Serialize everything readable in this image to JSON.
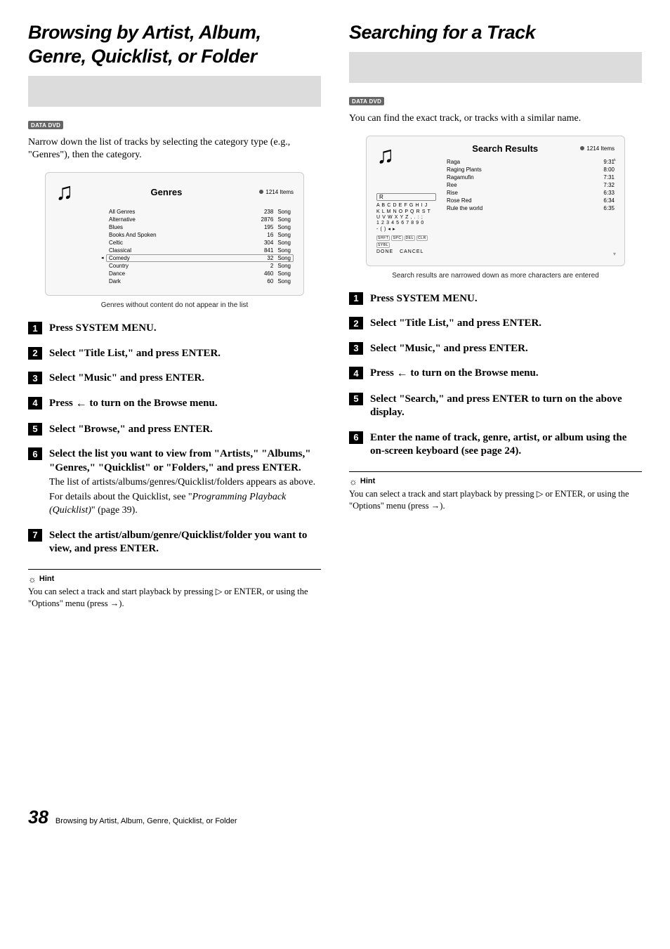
{
  "left": {
    "title": "Browsing by Artist, Album, Genre, Quicklist, or Folder",
    "tag": "DATA DVD",
    "intro": "Narrow down the list of tracks by selecting the category type (e.g., \"Genres\"), then the category.",
    "ss": {
      "header": "Genres",
      "items_label": "1214 Items",
      "rows": [
        {
          "name": "All Genres",
          "n": "238",
          "u": "Song"
        },
        {
          "name": "Alternative",
          "n": "2876",
          "u": "Song"
        },
        {
          "name": "Blues",
          "n": "195",
          "u": "Song"
        },
        {
          "name": "Books And Spoken",
          "n": "16",
          "u": "Song"
        },
        {
          "name": "Celtic",
          "n": "304",
          "u": "Song"
        },
        {
          "name": "Classical",
          "n": "841",
          "u": "Song"
        },
        {
          "name": "Comedy",
          "n": "32",
          "u": "Song"
        },
        {
          "name": "Country",
          "n": "2",
          "u": "Song"
        },
        {
          "name": "Dance",
          "n": "460",
          "u": "Song"
        },
        {
          "name": "Dark",
          "n": "60",
          "u": "Song"
        }
      ]
    },
    "caption": "Genres without content do not appear in the list",
    "steps": [
      {
        "n": "1",
        "t": "Press SYSTEM MENU."
      },
      {
        "n": "2",
        "t": "Select \"Title List,\" and press ENTER."
      },
      {
        "n": "3",
        "t": "Select \"Music\" and press ENTER."
      },
      {
        "n": "4",
        "t": "Press ← to turn on the Browse menu."
      },
      {
        "n": "5",
        "t": "Select \"Browse,\" and press ENTER."
      },
      {
        "n": "6",
        "t": "Select the list you want to view from \"Artists,\" \"Albums,\" \"Genres,\" \"Quicklist\" or \"Folders,\" and press ENTER.",
        "note1": "The list of artists/albums/genres/Quicklist/folders appears as above.",
        "note2_pre": "For details about the Quicklist, see \"",
        "note2_ital": "Programming Playback (Quicklist)",
        "note2_post": "\" (page 39)."
      },
      {
        "n": "7",
        "t": "Select the artist/album/genre/Quicklist/folder you want to view, and press ENTER."
      }
    ],
    "hint_label": "Hint",
    "hint": "You can select a track and start playback by pressing ▷ or ENTER, or using the \"Options\" menu (press →)."
  },
  "right": {
    "title": "Searching for a Track",
    "tag": "DATA DVD",
    "intro": "You can find the exact track, or tracks with a similar name.",
    "ss": {
      "header": "Search Results",
      "items_label": "1214 Items",
      "input": "R",
      "kb1": "A B C D E F G H I J",
      "kb2": "K L M N O P Q R S T",
      "kb3": "U V W X Y Z , . : ;",
      "kb4": "1 2 3 4 5 6 7 8 9 0",
      "kb5": "- ( )              ◂ ▸",
      "btns": [
        "SHFT",
        "SPC",
        "DEL",
        "CLR",
        "SYBL"
      ],
      "done": "DONE",
      "cancel": "CANCEL",
      "rows": [
        {
          "name": "Raga",
          "t": "9:31"
        },
        {
          "name": "Raging Plants",
          "t": "8:00"
        },
        {
          "name": "Ragamufin",
          "t": "7:31"
        },
        {
          "name": "Ree",
          "t": "7:32"
        },
        {
          "name": "Rise",
          "t": "6:33"
        },
        {
          "name": "Rose Red",
          "t": "6:34"
        },
        {
          "name": "Rule the world",
          "t": "6:35"
        }
      ]
    },
    "caption": "Search results are narrowed down as more characters are entered",
    "steps": [
      {
        "n": "1",
        "t": "Press SYSTEM MENU."
      },
      {
        "n": "2",
        "t": "Select \"Title List,\" and press ENTER."
      },
      {
        "n": "3",
        "t": "Select \"Music,\" and press ENTER."
      },
      {
        "n": "4",
        "t": "Press ← to turn on the Browse menu."
      },
      {
        "n": "5",
        "t": "Select \"Search,\" and press ENTER to turn on the above display."
      },
      {
        "n": "6",
        "t": "Enter the name of track, genre, artist, or album using the on-screen keyboard (see ",
        "ital_tail": "page 24",
        "post": ")."
      }
    ],
    "hint_label": "Hint",
    "hint": "You can select a track and start playback by pressing ▷ or ENTER, or using the \"Options\" menu (press →)."
  },
  "footer": {
    "page": "38",
    "text": "Browsing by Artist, Album, Genre, Quicklist, or Folder"
  }
}
